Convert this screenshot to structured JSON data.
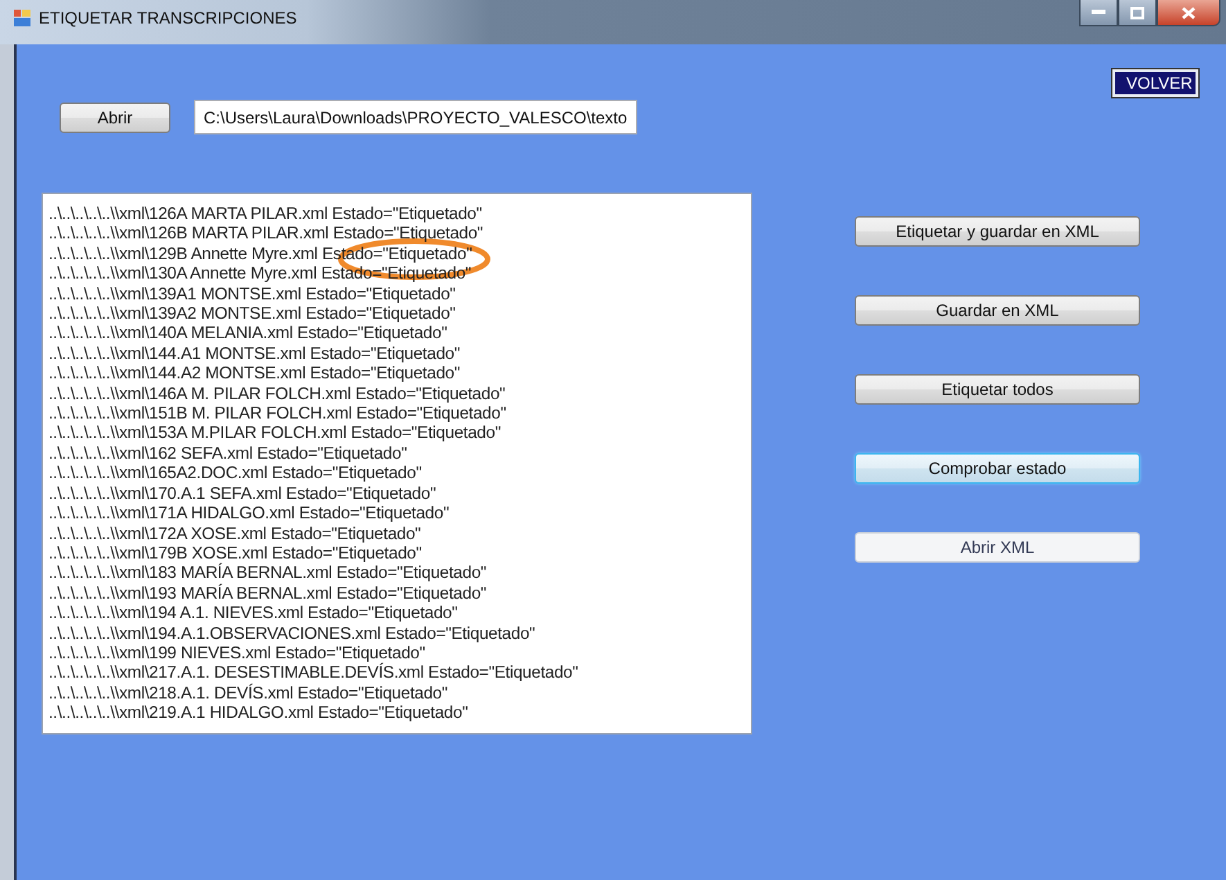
{
  "window": {
    "title": "ETIQUETAR TRANSCRIPCIONES"
  },
  "back_button": "VOLVER",
  "open_button": "Abrir",
  "path_field": {
    "value": "C:\\Users\\Laura\\Downloads\\PROYECTO_VALESCO\\texto"
  },
  "file_list": [
    "..\\..\\..\\..\\..\\\\xml\\126A MARTA PILAR.xml Estado=\"Etiquetado\"",
    "..\\..\\..\\..\\..\\\\xml\\126B MARTA PILAR.xml Estado=\"Etiquetado\"",
    "..\\..\\..\\..\\..\\\\xml\\129B Annette Myre.xml Estado=\"Etiquetado\"",
    "..\\..\\..\\..\\..\\\\xml\\130A Annette Myre.xml Estado=\"Etiquetado\"",
    "..\\..\\..\\..\\..\\\\xml\\139A1 MONTSE.xml Estado=\"Etiquetado\"",
    "..\\..\\..\\..\\..\\\\xml\\139A2 MONTSE.xml Estado=\"Etiquetado\"",
    "..\\..\\..\\..\\..\\\\xml\\140A MELANIA.xml Estado=\"Etiquetado\"",
    "..\\..\\..\\..\\..\\\\xml\\144.A1 MONTSE.xml Estado=\"Etiquetado\"",
    "..\\..\\..\\..\\..\\\\xml\\144.A2 MONTSE.xml Estado=\"Etiquetado\"",
    "..\\..\\..\\..\\..\\\\xml\\146A M. PILAR FOLCH.xml Estado=\"Etiquetado\"",
    "..\\..\\..\\..\\..\\\\xml\\151B M. PILAR FOLCH.xml Estado=\"Etiquetado\"",
    "..\\..\\..\\..\\..\\\\xml\\153A M.PILAR FOLCH.xml Estado=\"Etiquetado\"",
    "..\\..\\..\\..\\..\\\\xml\\162 SEFA.xml Estado=\"Etiquetado\"",
    "..\\..\\..\\..\\..\\\\xml\\165A2.DOC.xml Estado=\"Etiquetado\"",
    "..\\..\\..\\..\\..\\\\xml\\170.A.1 SEFA.xml Estado=\"Etiquetado\"",
    "..\\..\\..\\..\\..\\\\xml\\171A HIDALGO.xml Estado=\"Etiquetado\"",
    "..\\..\\..\\..\\..\\\\xml\\172A XOSE.xml Estado=\"Etiquetado\"",
    "..\\..\\..\\..\\..\\\\xml\\179B XOSE.xml Estado=\"Etiquetado\"",
    "..\\..\\..\\..\\..\\\\xml\\183 MARÍA BERNAL.xml Estado=\"Etiquetado\"",
    "..\\..\\..\\..\\..\\\\xml\\193 MARÍA BERNAL.xml Estado=\"Etiquetado\"",
    "..\\..\\..\\..\\..\\\\xml\\194 A.1. NIEVES.xml Estado=\"Etiquetado\"",
    "..\\..\\..\\..\\..\\\\xml\\194.A.1.OBSERVACIONES.xml Estado=\"Etiquetado\"",
    "..\\..\\..\\..\\..\\\\xml\\199 NIEVES.xml Estado=\"Etiquetado\"",
    "..\\..\\..\\..\\..\\\\xml\\217.A.1. DESESTIMABLE.DEVÍS.xml Estado=\"Etiquetado\"",
    "..\\..\\..\\..\\..\\\\xml\\218.A.1. DEVÍS.xml Estado=\"Etiquetado\"",
    "..\\..\\..\\..\\..\\\\xml\\219.A.1 HIDALGO.xml Estado=\"Etiquetado\""
  ],
  "action_buttons": [
    {
      "label": "Etiquetar y guardar en XML",
      "kind": "normal",
      "focused": false
    },
    {
      "label": "Guardar en XML",
      "kind": "normal",
      "focused": false
    },
    {
      "label": "Etiquetar todos",
      "kind": "normal",
      "focused": false
    },
    {
      "label": "Comprobar estado",
      "kind": "normal",
      "focused": true
    },
    {
      "label": "Abrir XML",
      "kind": "flat",
      "focused": false
    }
  ]
}
